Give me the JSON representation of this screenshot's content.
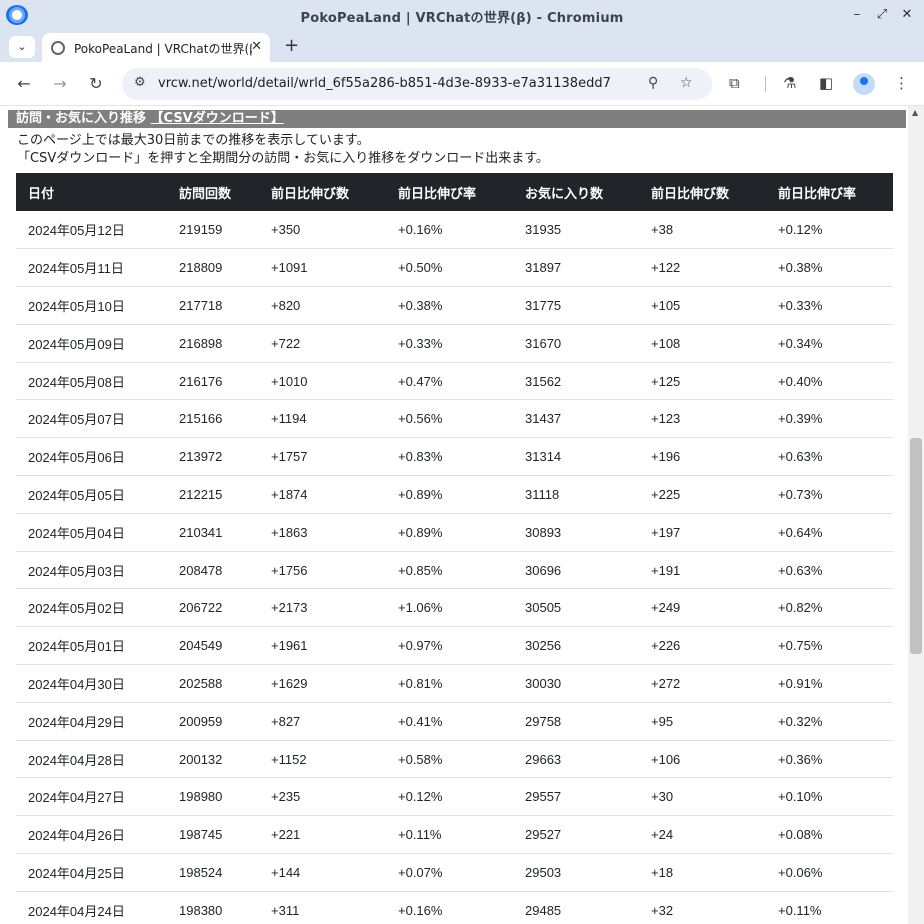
{
  "window": {
    "title": "PokoPeaLand | VRChatの世界(β) - Chromium",
    "minimize_icon": "–",
    "restore_icon": "⤢",
    "close_icon": "✕"
  },
  "tabs": [
    {
      "title": "PokoPeaLand | VRChatの世界(β)",
      "close": "✕"
    }
  ],
  "tabstrip": {
    "search_icon": "⌄",
    "new_tab": "+"
  },
  "toolbar": {
    "back": "←",
    "forward": "→",
    "reload": "↻",
    "url": "vrcw.net/world/detail/wrld_6f55a286-b851-4d3e-8933-e7a31138edd7",
    "site_info_icon": "⚙",
    "zoom_icon": "⚲",
    "star_icon": "☆",
    "extensions_icon": "⧉",
    "labs_icon": "⚗",
    "sidepanel_icon": "◧",
    "menu_icon": "⋮"
  },
  "section": {
    "header": "訪問・お気に入り推移 ",
    "csv_link": "【CSVダウンロード】",
    "note1": "このページ上では最大30日前までの推移を表示しています。",
    "note2": "「CSVダウンロード」を押すと全期間分の訪問・お気に入り推移をダウンロード出来ます。"
  },
  "table": {
    "headers": [
      "日付",
      "訪問回数",
      "前日比伸び数",
      "前日比伸び率",
      "お気に入り数",
      "前日比伸び数",
      "前日比伸び率"
    ],
    "rows": [
      [
        "2024年05月12日",
        "219159",
        "+350",
        "+0.16%",
        "31935",
        "+38",
        "+0.12%"
      ],
      [
        "2024年05月11日",
        "218809",
        "+1091",
        "+0.50%",
        "31897",
        "+122",
        "+0.38%"
      ],
      [
        "2024年05月10日",
        "217718",
        "+820",
        "+0.38%",
        "31775",
        "+105",
        "+0.33%"
      ],
      [
        "2024年05月09日",
        "216898",
        "+722",
        "+0.33%",
        "31670",
        "+108",
        "+0.34%"
      ],
      [
        "2024年05月08日",
        "216176",
        "+1010",
        "+0.47%",
        "31562",
        "+125",
        "+0.40%"
      ],
      [
        "2024年05月07日",
        "215166",
        "+1194",
        "+0.56%",
        "31437",
        "+123",
        "+0.39%"
      ],
      [
        "2024年05月06日",
        "213972",
        "+1757",
        "+0.83%",
        "31314",
        "+196",
        "+0.63%"
      ],
      [
        "2024年05月05日",
        "212215",
        "+1874",
        "+0.89%",
        "31118",
        "+225",
        "+0.73%"
      ],
      [
        "2024年05月04日",
        "210341",
        "+1863",
        "+0.89%",
        "30893",
        "+197",
        "+0.64%"
      ],
      [
        "2024年05月03日",
        "208478",
        "+1756",
        "+0.85%",
        "30696",
        "+191",
        "+0.63%"
      ],
      [
        "2024年05月02日",
        "206722",
        "+2173",
        "+1.06%",
        "30505",
        "+249",
        "+0.82%"
      ],
      [
        "2024年05月01日",
        "204549",
        "+1961",
        "+0.97%",
        "30256",
        "+226",
        "+0.75%"
      ],
      [
        "2024年04月30日",
        "202588",
        "+1629",
        "+0.81%",
        "30030",
        "+272",
        "+0.91%"
      ],
      [
        "2024年04月29日",
        "200959",
        "+827",
        "+0.41%",
        "29758",
        "+95",
        "+0.32%"
      ],
      [
        "2024年04月28日",
        "200132",
        "+1152",
        "+0.58%",
        "29663",
        "+106",
        "+0.36%"
      ],
      [
        "2024年04月27日",
        "198980",
        "+235",
        "+0.12%",
        "29557",
        "+30",
        "+0.10%"
      ],
      [
        "2024年04月26日",
        "198745",
        "+221",
        "+0.11%",
        "29527",
        "+24",
        "+0.08%"
      ],
      [
        "2024年04月25日",
        "198524",
        "+144",
        "+0.07%",
        "29503",
        "+18",
        "+0.06%"
      ],
      [
        "2024年04月24日",
        "198380",
        "+311",
        "+0.16%",
        "29485",
        "+32",
        "+0.11%"
      ]
    ]
  },
  "colors": {
    "titlebar_bg": "#dce3f1",
    "table_header_bg": "#212529",
    "section_header_bg": "#7f7f7f"
  }
}
